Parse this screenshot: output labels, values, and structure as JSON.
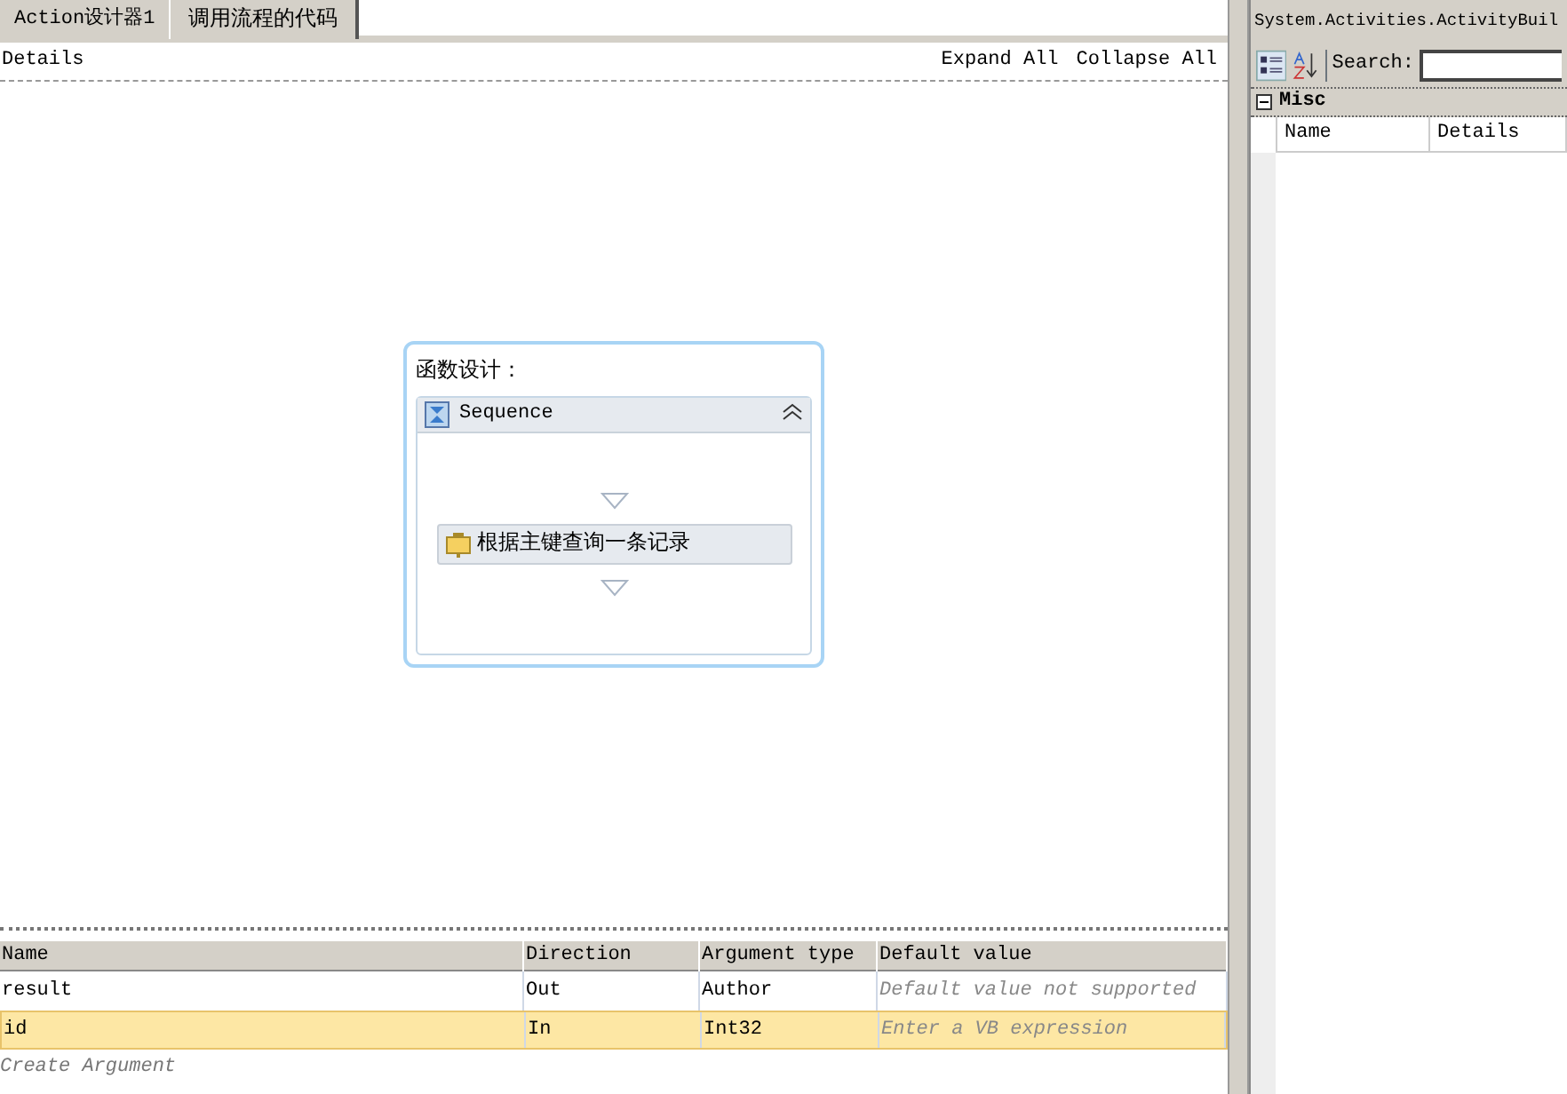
{
  "tabs": [
    {
      "label": "Action设计器1",
      "selected": true
    },
    {
      "label": "调用流程的代码",
      "selected": false
    }
  ],
  "designer_toolbar": {
    "breadcrumb": "Details",
    "links": [
      "Expand All",
      "Collapse All"
    ]
  },
  "designer": {
    "title": "函数设计：",
    "sequence": {
      "label": "Sequence",
      "expanded": true,
      "activities": [
        {
          "label": "根据主键查询一条记录"
        }
      ]
    }
  },
  "arguments": {
    "columns": [
      "Name",
      "Direction",
      "Argument type",
      "Default value"
    ],
    "rows": [
      {
        "name": "result",
        "direction": "Out",
        "type": "Author",
        "default_placeholder": "Default value not supported",
        "selected": false
      },
      {
        "name": "id",
        "direction": "In",
        "type": "Int32",
        "default_placeholder": "Enter a VB expression",
        "selected": true
      }
    ],
    "create_label": "Create Argument"
  },
  "properties": {
    "title": "System.Activities.ActivityBuil",
    "search_label": "Search:",
    "category": {
      "label": "Misc",
      "expanded": true
    },
    "columns": [
      "Name",
      "Details"
    ]
  }
}
